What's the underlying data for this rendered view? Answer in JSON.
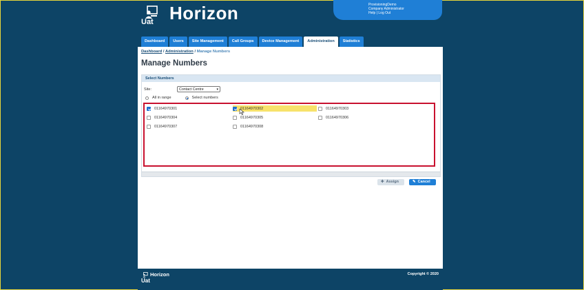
{
  "app": {
    "title": "Horizon",
    "subtitle": "Uat"
  },
  "user": {
    "name": "ProvisioningDemo",
    "role": "Company Administrator",
    "help": "Help",
    "separator": "|",
    "logout": "Log Out"
  },
  "nav": [
    {
      "label": "Dashboard",
      "active": false
    },
    {
      "label": "Users",
      "active": false
    },
    {
      "label": "Site Management",
      "active": false
    },
    {
      "label": "Call Groups",
      "active": false
    },
    {
      "label": "Device Management",
      "active": false
    },
    {
      "label": "Administration",
      "active": true
    },
    {
      "label": "Statistics",
      "active": false
    }
  ],
  "breadcrumb": {
    "items": [
      "Dashboard",
      "Administration"
    ],
    "separator": "/",
    "current": "Manage Numbers"
  },
  "page": {
    "title": "Manage Numbers"
  },
  "panel": {
    "header": "Select Numbers",
    "site_label": "Site:",
    "site_value": "Contact Centre",
    "radio_all": "All in range",
    "radio_select": "Select numbers",
    "selected_mode": "select"
  },
  "numbers": [
    {
      "value": "01164970301",
      "checked": true
    },
    {
      "value": "01164970302",
      "checked": true
    },
    {
      "value": "01164970303",
      "checked": false
    },
    {
      "value": "01164970304",
      "checked": false
    },
    {
      "value": "01164970305",
      "checked": false
    },
    {
      "value": "01164970306",
      "checked": false
    },
    {
      "value": "01164970307",
      "checked": false
    },
    {
      "value": "01164970308",
      "checked": false
    }
  ],
  "buttons": {
    "assign": "Assign",
    "cancel": "Cancel"
  },
  "footer": {
    "app": "Horizon",
    "sub": "Uat",
    "copyright": "Copyright © 2020"
  },
  "colors": {
    "background": "#0d4466",
    "accent": "#1f7fd6",
    "highlight": "#f7e26b",
    "selection_border": "#c8102e"
  }
}
